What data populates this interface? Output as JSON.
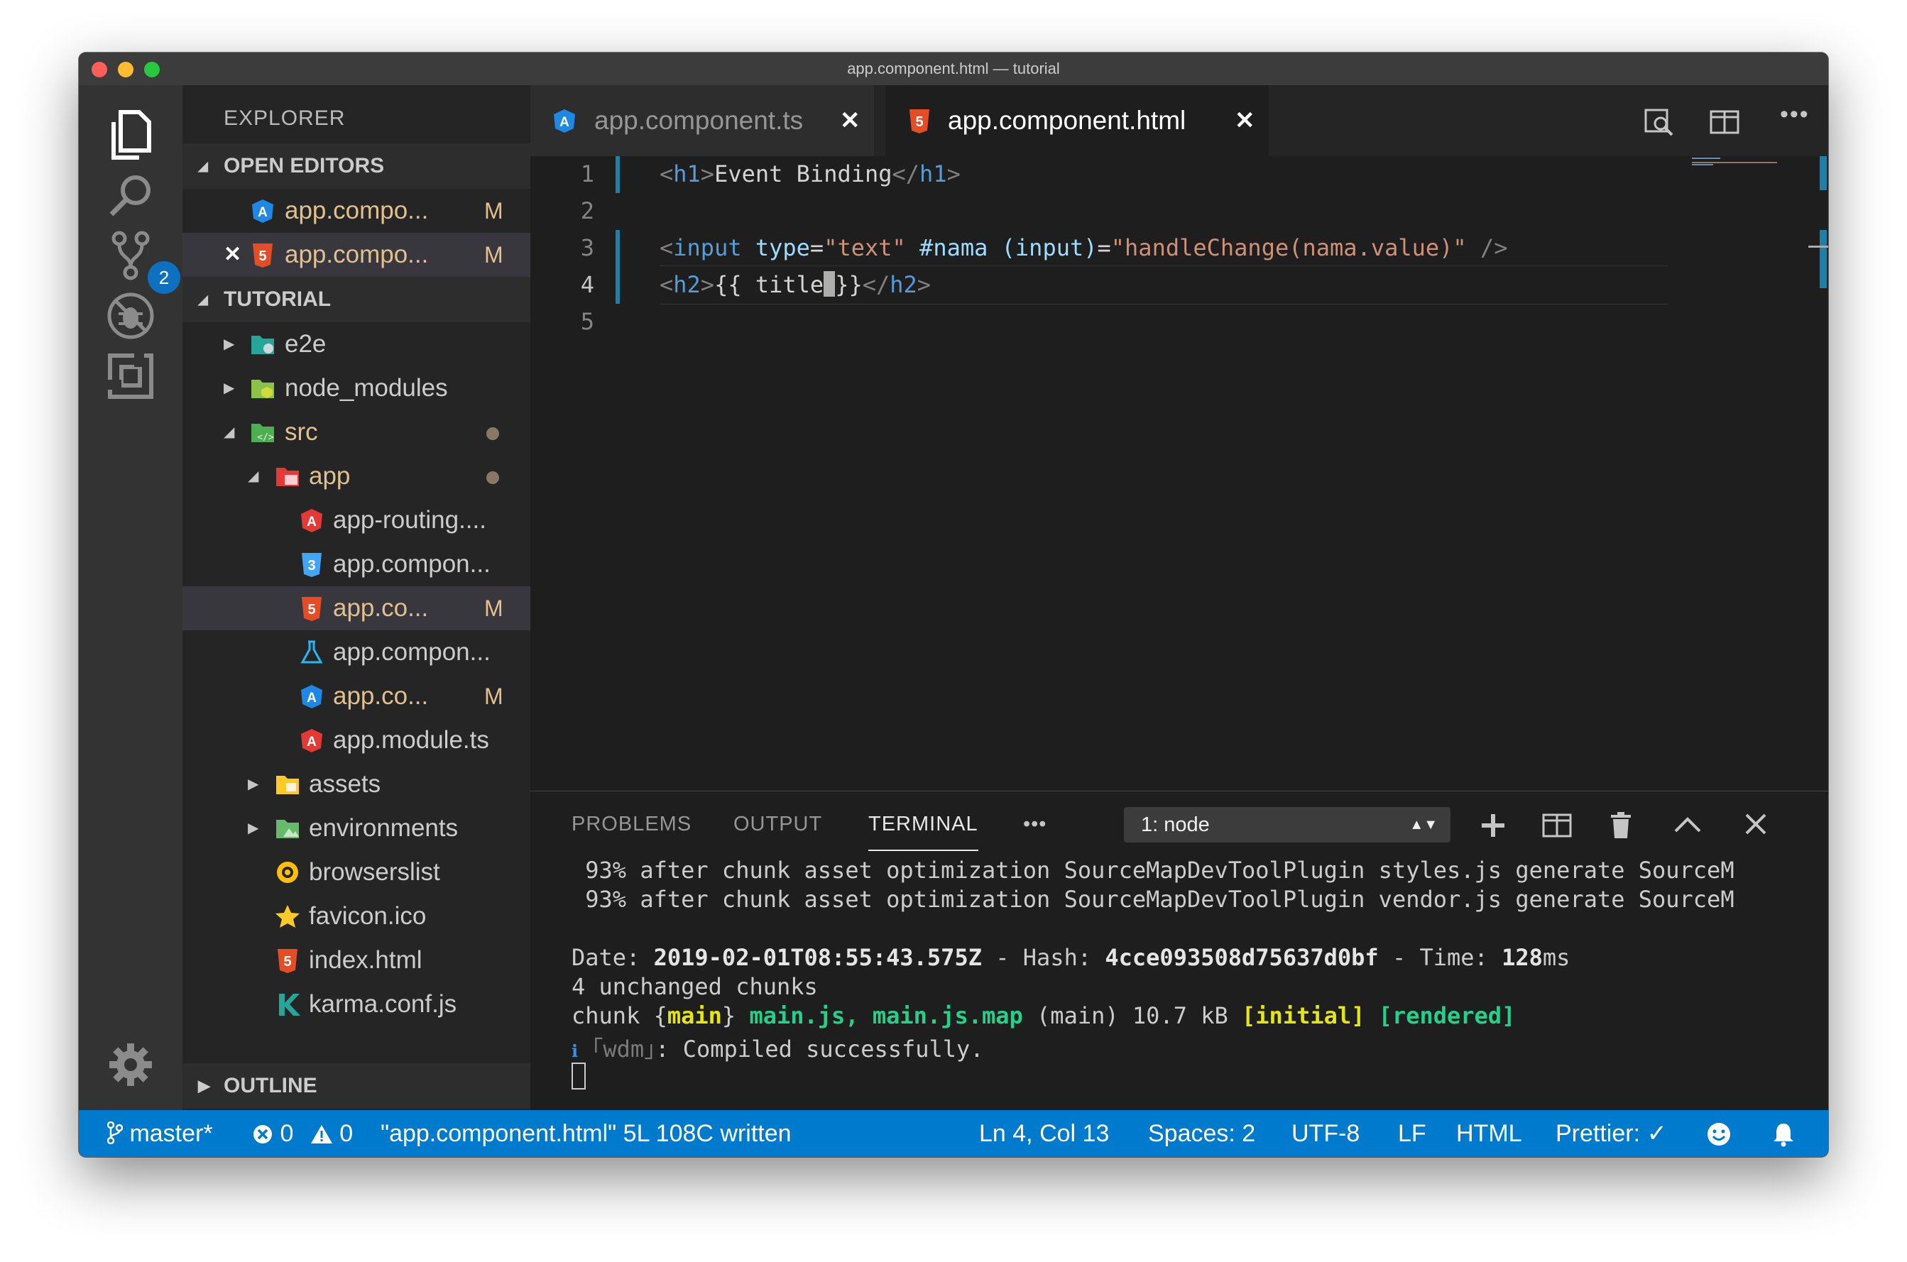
{
  "window": {
    "title": "app.component.html — tutorial"
  },
  "activity": {
    "scm_badge": "2"
  },
  "sidebar": {
    "title": "EXPLORER",
    "open_editors_label": "OPEN EDITORS",
    "open_editors": [
      {
        "name": "app.compo...",
        "status": "M"
      },
      {
        "name": "app.compo...",
        "status": "M"
      }
    ],
    "project_label": "TUTORIAL",
    "tree": [
      {
        "name": "e2e"
      },
      {
        "name": "node_modules"
      },
      {
        "name": "src"
      },
      {
        "name": "app"
      },
      {
        "name": "app-routing...."
      },
      {
        "name": "app.compon..."
      },
      {
        "name": "app.co...",
        "status": "M"
      },
      {
        "name": "app.compon..."
      },
      {
        "name": "app.co...",
        "status": "M"
      },
      {
        "name": "app.module.ts"
      },
      {
        "name": "assets"
      },
      {
        "name": "environments"
      },
      {
        "name": "browserslist"
      },
      {
        "name": "favicon.ico"
      },
      {
        "name": "index.html"
      },
      {
        "name": "karma.conf.js"
      }
    ],
    "outline_label": "OUTLINE"
  },
  "tabs": [
    {
      "label": "app.component.ts"
    },
    {
      "label": "app.component.html"
    }
  ],
  "editor": {
    "line_numbers": [
      "1",
      "2",
      "3",
      "4",
      "5"
    ],
    "l1": {
      "lt1": "<",
      "tag1": "h1",
      "gt1": ">",
      "text": "Event Binding",
      "lt2": "</",
      "tag2": "h1",
      "gt2": ">"
    },
    "l3": {
      "lt": "<",
      "tag": "input",
      "sp1": " ",
      "a1": "type",
      "eq1": "=",
      "v1": "\"text\"",
      "sp2": " ",
      "a2": "#nama",
      "sp3": " ",
      "a3": "(input)",
      "eq2": "=",
      "v2": "\"handleChange(nama.value)\"",
      "end": " />"
    },
    "l4": {
      "lt1": "<",
      "tag1": "h2",
      "gt1": ">",
      "text1": "{{ title",
      "text2": "}}",
      "lt2": "</",
      "tag2": "h2",
      "gt2": ">"
    }
  },
  "panel": {
    "tabs": [
      "PROBLEMS",
      "OUTPUT",
      "TERMINAL"
    ],
    "more": "•••",
    "terminal_select": "1: node",
    "lines": {
      "l1": " 93% after chunk asset optimization SourceMapDevToolPlugin styles.js generate SourceM",
      "l2": " 93% after chunk asset optimization SourceMapDevToolPlugin vendor.js generate SourceM",
      "l3": {
        "a": "Date: ",
        "b": "2019-02-01T08:55:43.575Z",
        "c": " - Hash: ",
        "d": "4cce093508d75637d0bf",
        "e": " - Time: ",
        "f": "128",
        "g": "ms"
      },
      "l4": "4 unchanged chunks",
      "l5": {
        "a": "chunk {",
        "b": "main",
        "c": "} ",
        "d": "main.js, main.js.map",
        "e": " (main) 10.7 kB ",
        "f": "[initial]",
        "g": " ",
        "h": "[rendered]"
      },
      "l6": {
        "a": "ℹ",
        "b": " ｢wdm｣",
        "c": ": Compiled successfully."
      }
    }
  },
  "status": {
    "branch": "master*",
    "errors": "0",
    "warnings": "0",
    "message": "\"app.component.html\" 5L 108C written",
    "position": "Ln 4, Col 13",
    "spaces": "Spaces: 2",
    "encoding": "UTF-8",
    "eol": "LF",
    "language": "HTML",
    "prettier": "Prettier: ✓"
  }
}
